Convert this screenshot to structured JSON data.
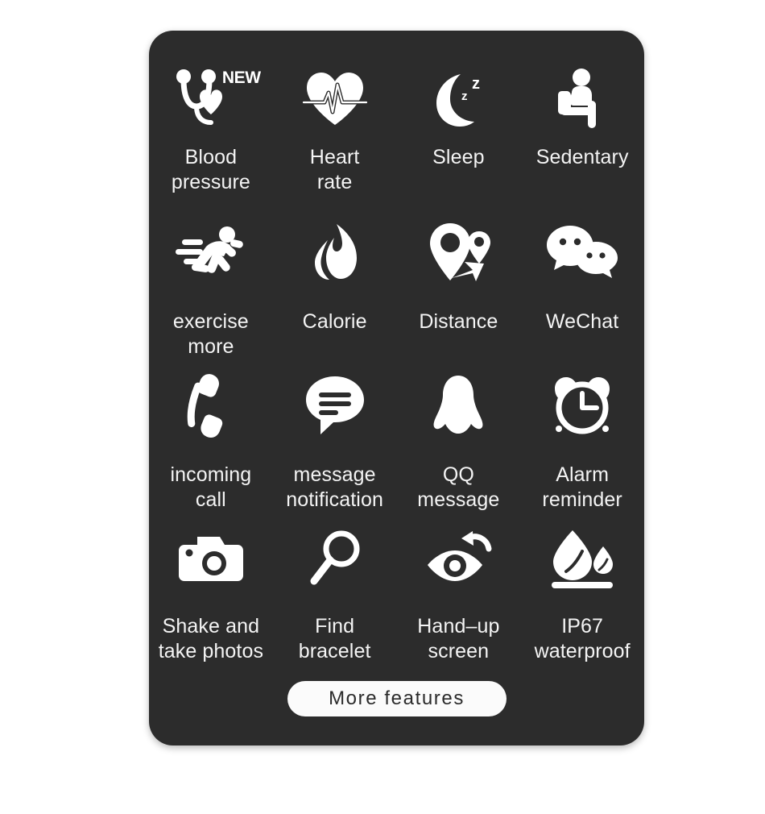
{
  "card": {
    "background_color": "#2c2c2c",
    "text_color": "#f4f4f4"
  },
  "features": [
    {
      "icon": "stethoscope-blood-pressure-icon",
      "label": "Blood\npressure",
      "badge": "NEW"
    },
    {
      "icon": "heart-rate-ecg-icon",
      "label": "Heart\nrate"
    },
    {
      "icon": "sleep-moon-zzz-icon",
      "label": "Sleep"
    },
    {
      "icon": "sedentary-seated-person-icon",
      "label": "Sedentary"
    },
    {
      "icon": "running-person-icon",
      "label": "exercise\nmore"
    },
    {
      "icon": "calorie-flame-icon",
      "label": "Calorie"
    },
    {
      "icon": "distance-map-pins-icon",
      "label": "Distance"
    },
    {
      "icon": "wechat-bubbles-icon",
      "label": "WeChat"
    },
    {
      "icon": "incoming-call-handset-icon",
      "label": "incoming\ncall"
    },
    {
      "icon": "message-bubble-icon",
      "label": "message\nnotification"
    },
    {
      "icon": "qq-penguin-icon",
      "label": "QQ\nmessage"
    },
    {
      "icon": "alarm-clock-icon",
      "label": "Alarm\nreminder"
    },
    {
      "icon": "camera-shutter-icon",
      "label": "Shake and\ntake photos"
    },
    {
      "icon": "magnifier-search-icon",
      "label": "Find\nbracelet"
    },
    {
      "icon": "eye-raise-hand-icon",
      "label": "Hand–up\nscreen"
    },
    {
      "icon": "water-droplet-icon",
      "label": "IP67\nwaterproof"
    }
  ],
  "more_button": {
    "label": "More features"
  }
}
